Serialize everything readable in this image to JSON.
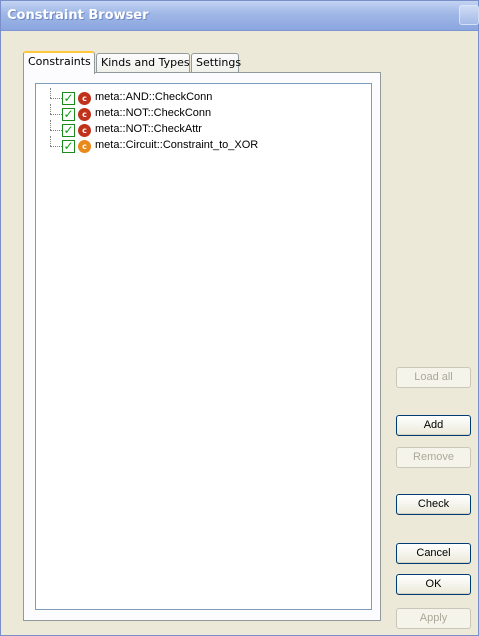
{
  "window": {
    "title": "Constraint Browser"
  },
  "tabs": [
    {
      "label": "Constraints",
      "active": true
    },
    {
      "label": "Kinds and Types",
      "active": false
    },
    {
      "label": "Settings",
      "active": false
    }
  ],
  "tree": {
    "items": [
      {
        "label": "meta::AND::CheckConn",
        "checked": true,
        "icon": "constraint-c-icon",
        "icon_color": "#c1321b"
      },
      {
        "label": "meta::NOT::CheckConn",
        "checked": true,
        "icon": "constraint-c-icon",
        "icon_color": "#c1321b"
      },
      {
        "label": "meta::NOT::CheckAttr",
        "checked": true,
        "icon": "constraint-c-icon",
        "icon_color": "#c1321b"
      },
      {
        "label": "meta::Circuit::Constraint_to_XOR",
        "checked": true,
        "icon": "constraint-c-icon",
        "icon_color": "#e8891a"
      }
    ]
  },
  "buttons": {
    "load_all": "Load all",
    "add": "Add",
    "remove": "Remove",
    "check": "Check",
    "cancel": "Cancel",
    "ok": "OK",
    "apply": "Apply"
  },
  "icons": {
    "check": "✓",
    "constraint": "c"
  }
}
